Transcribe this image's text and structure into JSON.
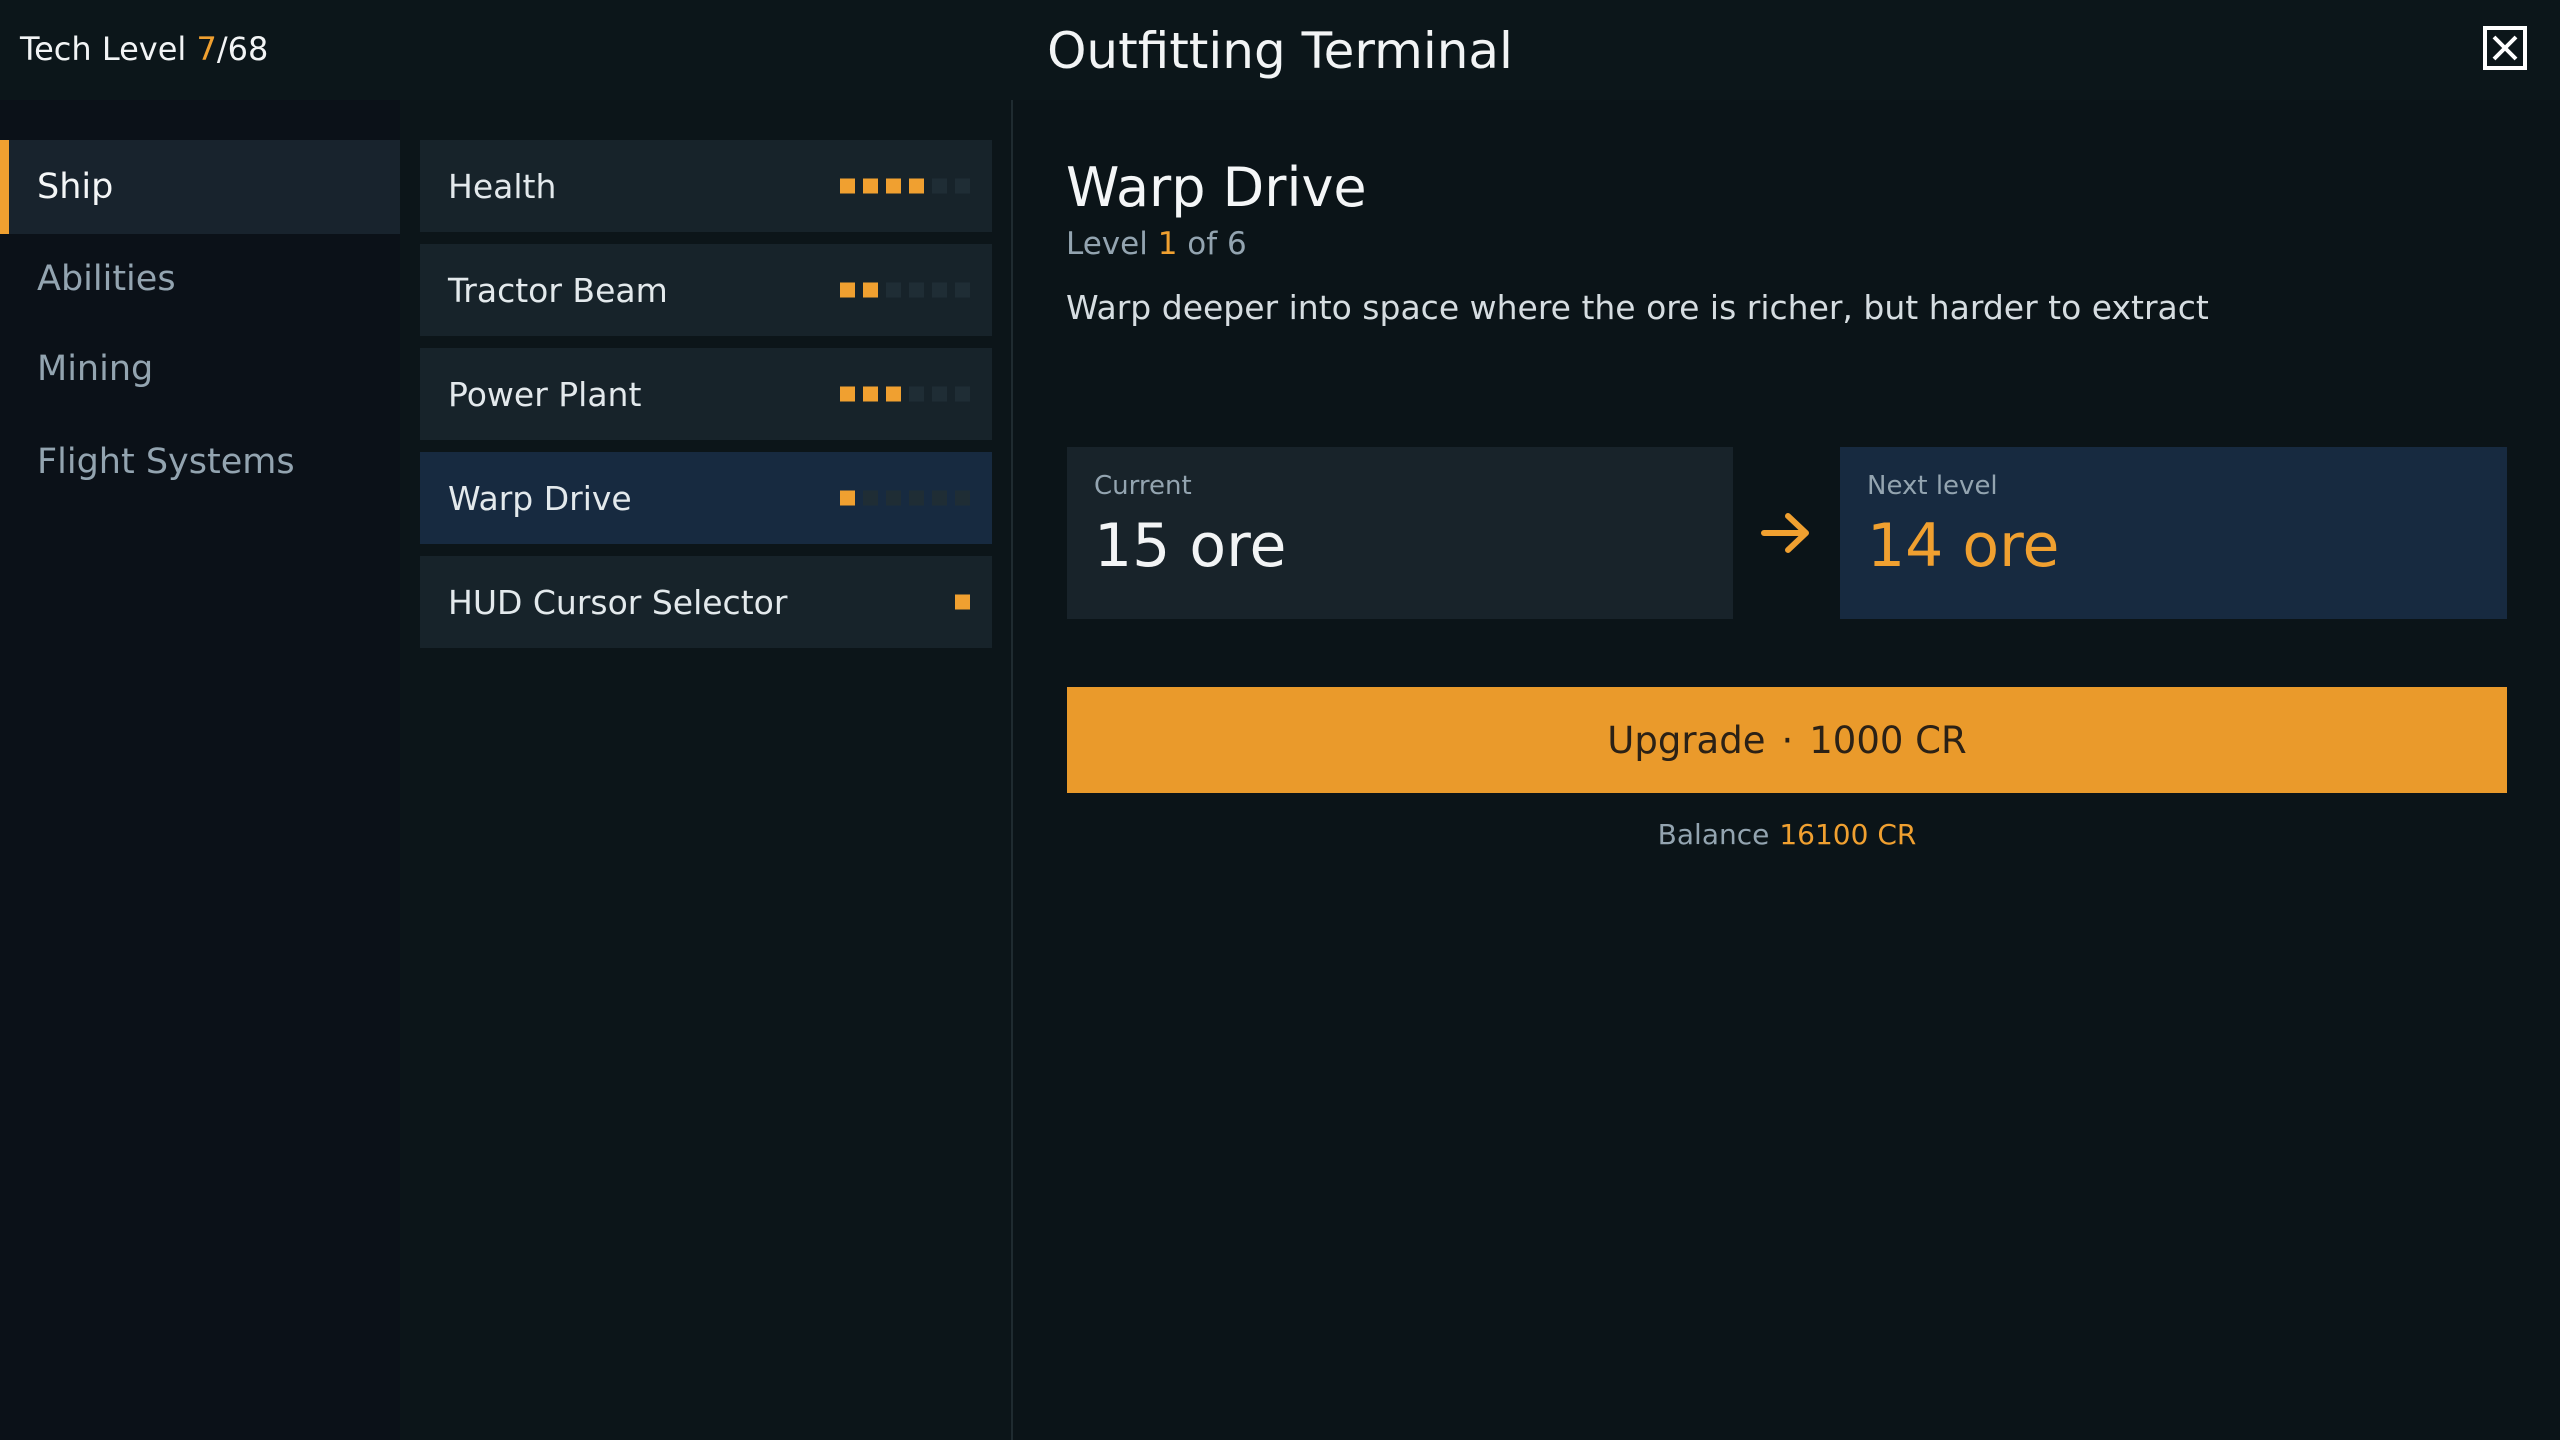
{
  "header": {
    "tech_label": "Tech Level",
    "tech_current": "7",
    "tech_max": "/68",
    "title": "Outfitting Terminal"
  },
  "sidebar": {
    "items": [
      {
        "label": "Ship",
        "active": true
      },
      {
        "label": "Abilities"
      },
      {
        "label": "Mining"
      },
      {
        "label": "Flight Systems"
      }
    ]
  },
  "upgrades": [
    {
      "label": "Health",
      "level": 4,
      "max": 6
    },
    {
      "label": "Tractor Beam",
      "level": 2,
      "max": 6
    },
    {
      "label": "Power Plant",
      "level": 3,
      "max": 6
    },
    {
      "label": "Warp Drive",
      "level": 1,
      "max": 6,
      "selected": true
    },
    {
      "label": "HUD Cursor Selector",
      "level": 1,
      "max": 1
    }
  ],
  "detail": {
    "name": "Warp Drive",
    "level_prefix": "Level",
    "level_current": "1",
    "level_suffix": "of 6",
    "description": "Warp deeper into space where the ore is richer, but harder to extract",
    "current_label": "Current",
    "current_value": "15 ore",
    "next_label": "Next level",
    "next_value": "14 ore",
    "upgrade_label": "Upgrade",
    "upgrade_sep": "·",
    "upgrade_cost": "1000 CR",
    "balance_label": "Balance",
    "balance_value": "16100 CR"
  },
  "colors": {
    "accent": "#f0a030",
    "background": "#0b1418",
    "selected": "#172a40"
  },
  "icons": {
    "close": "close-icon",
    "arrow": "arrow-right-icon"
  }
}
